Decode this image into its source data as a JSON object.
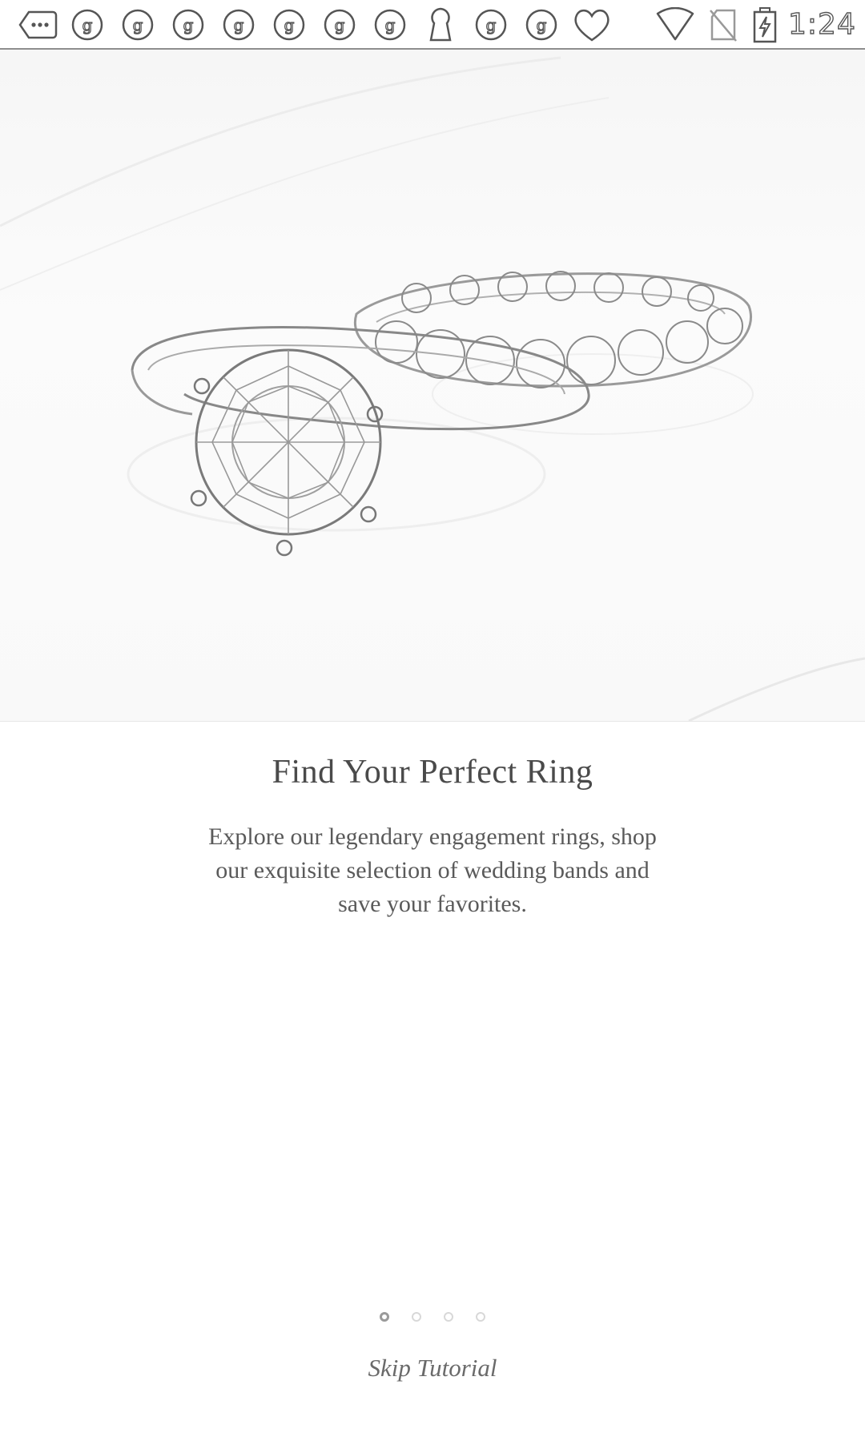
{
  "status_bar": {
    "icons": [
      "more-notifications-icon",
      "app-notification-icon",
      "app-notification-icon",
      "app-notification-icon",
      "app-notification-icon",
      "app-notification-icon",
      "app-notification-icon",
      "app-notification-icon",
      "keyhole-icon",
      "app-notification-icon",
      "app-notification-icon",
      "heart-icon",
      "wifi-icon",
      "no-sim-icon",
      "battery-charging-icon"
    ],
    "time": "1:24"
  },
  "onboarding": {
    "title": "Find Your Perfect Ring",
    "description": "Explore our legendary engagement rings, shop our exquisite selection of wedding bands and save your favorites.",
    "skip_label": "Skip Tutorial",
    "page_count": 4,
    "current_page": 1
  },
  "colors": {
    "text": "#4a4a4a",
    "background": "#ffffff",
    "divider": "#8e8e8e"
  }
}
